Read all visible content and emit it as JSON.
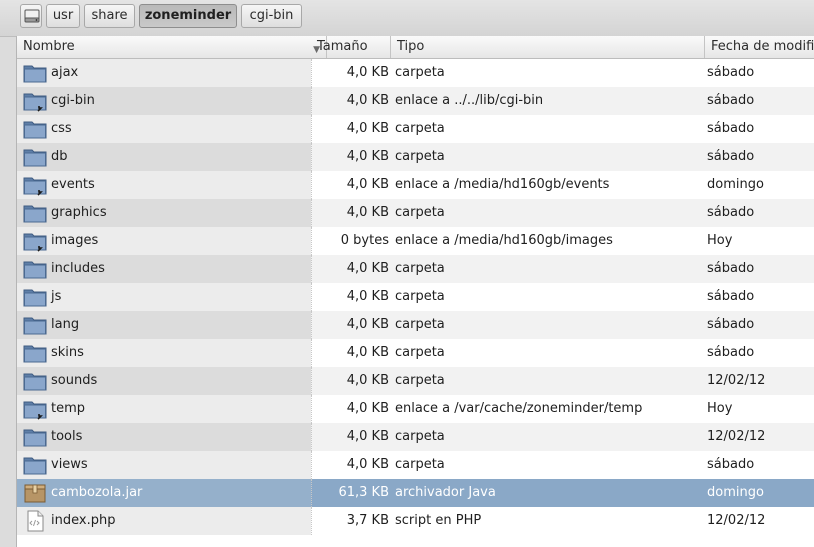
{
  "pathbar": {
    "drive_icon": "drive-icon",
    "buttons": [
      {
        "label": "usr",
        "active": false
      },
      {
        "label": "share",
        "active": false
      },
      {
        "label": "zoneminder",
        "active": true
      },
      {
        "label": "cgi-bin",
        "active": false
      }
    ]
  },
  "columns": {
    "name": "Nombre",
    "size": "Tamaño",
    "type": "Tipo",
    "date": "Fecha de modificación",
    "sort_indicator": "▼"
  },
  "files": [
    {
      "name": "ajax",
      "size": "4,0 KB",
      "type": "carpeta",
      "date": "sábado",
      "icon": "folder-icon"
    },
    {
      "name": "cgi-bin",
      "size": "4,0 KB",
      "type": "enlace a ../../lib/cgi-bin",
      "date": "sábado",
      "icon": "folder-link-icon"
    },
    {
      "name": "css",
      "size": "4,0 KB",
      "type": "carpeta",
      "date": "sábado",
      "icon": "folder-icon"
    },
    {
      "name": "db",
      "size": "4,0 KB",
      "type": "carpeta",
      "date": "sábado",
      "icon": "folder-icon"
    },
    {
      "name": "events",
      "size": "4,0 KB",
      "type": "enlace a /media/hd160gb/events",
      "date": "domingo",
      "icon": "folder-link-icon"
    },
    {
      "name": "graphics",
      "size": "4,0 KB",
      "type": "carpeta",
      "date": "sábado",
      "icon": "folder-icon"
    },
    {
      "name": "images",
      "size": "0 bytes",
      "type": "enlace a /media/hd160gb/images",
      "date": "Hoy",
      "icon": "folder-link-icon"
    },
    {
      "name": "includes",
      "size": "4,0 KB",
      "type": "carpeta",
      "date": "sábado",
      "icon": "folder-icon"
    },
    {
      "name": "js",
      "size": "4,0 KB",
      "type": "carpeta",
      "date": "sábado",
      "icon": "folder-icon"
    },
    {
      "name": "lang",
      "size": "4,0 KB",
      "type": "carpeta",
      "date": "sábado",
      "icon": "folder-icon"
    },
    {
      "name": "skins",
      "size": "4,0 KB",
      "type": "carpeta",
      "date": "sábado",
      "icon": "folder-icon"
    },
    {
      "name": "sounds",
      "size": "4,0 KB",
      "type": "carpeta",
      "date": "12/02/12",
      "icon": "folder-icon"
    },
    {
      "name": "temp",
      "size": "4,0 KB",
      "type": "enlace a /var/cache/zoneminder/temp",
      "date": "Hoy",
      "icon": "folder-link-icon"
    },
    {
      "name": "tools",
      "size": "4,0 KB",
      "type": "carpeta",
      "date": "12/02/12",
      "icon": "folder-icon"
    },
    {
      "name": "views",
      "size": "4,0 KB",
      "type": "carpeta",
      "date": "sábado",
      "icon": "folder-icon"
    },
    {
      "name": "cambozola.jar",
      "size": "61,3 KB",
      "type": "archivador Java",
      "date": "domingo",
      "icon": "archive-icon",
      "selected": true
    },
    {
      "name": "index.php",
      "size": "3,7 KB",
      "type": "script en PHP",
      "date": "12/02/12",
      "icon": "php-file-icon"
    }
  ],
  "colors": {
    "selection": "#8aa8c7",
    "folder": "#7a98c0"
  }
}
